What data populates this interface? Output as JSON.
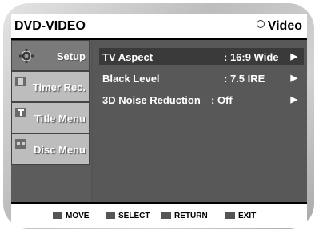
{
  "header": {
    "title": "DVD-VIDEO",
    "mode": "Video"
  },
  "sidebar": {
    "items": [
      {
        "label": "Setup",
        "active": true
      },
      {
        "label": "Timer Rec."
      },
      {
        "label": "Title Menu"
      },
      {
        "label": "Disc Menu"
      }
    ]
  },
  "menu": {
    "rows": [
      {
        "label": "TV Aspect",
        "value": ": 16:9 Wide",
        "arrow": "▶"
      },
      {
        "label": "Black Level",
        "value": ": 7.5 IRE",
        "arrow": "▶"
      },
      {
        "label": "3D Noise Reduction",
        "value": ": Off",
        "arrow": "▶"
      }
    ]
  },
  "footer": {
    "move": "MOVE",
    "select": "SELECT",
    "return": "RETURN",
    "exit": "EXIT"
  }
}
